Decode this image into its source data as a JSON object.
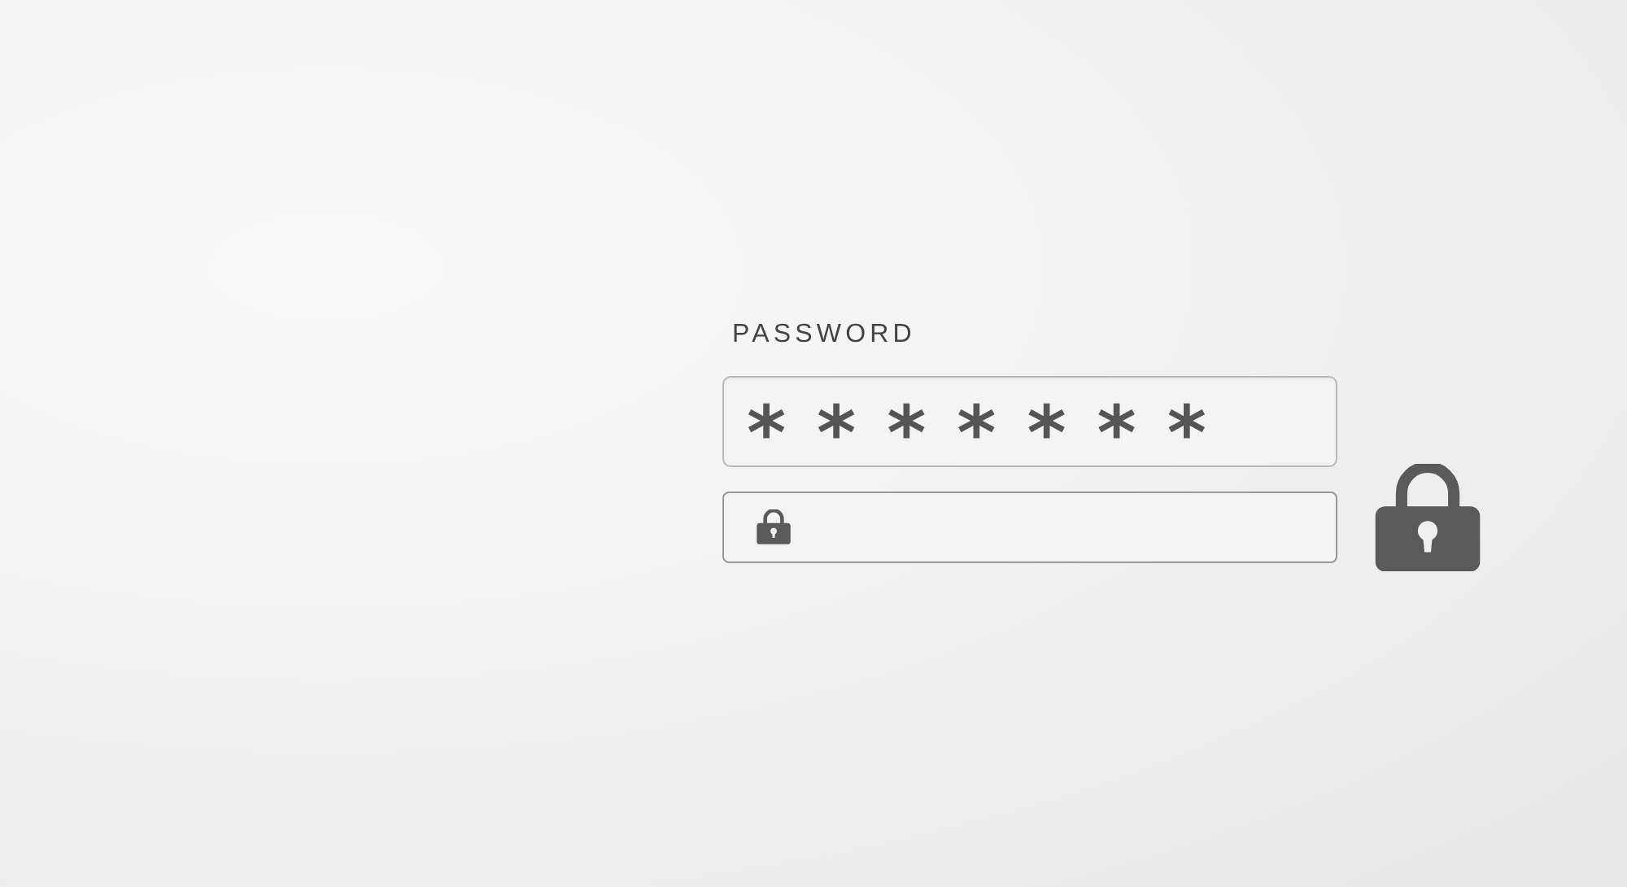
{
  "label": "PASSWORD",
  "password_field": {
    "value": "*******"
  }
}
